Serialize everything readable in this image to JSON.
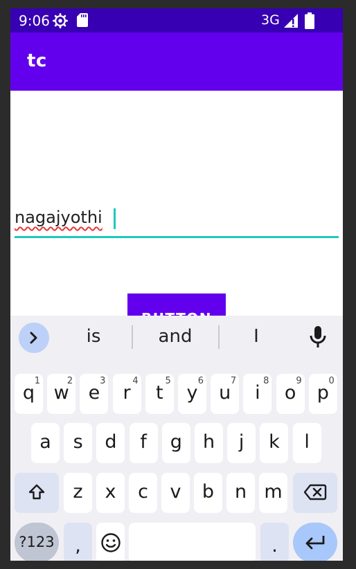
{
  "status_bar": {
    "time": "9:06",
    "network": "3G",
    "icons": [
      "gear-icon",
      "sd-card-icon",
      "signal-icon",
      "battery-icon"
    ]
  },
  "app_bar": {
    "title": "tc"
  },
  "form": {
    "text_value": "nagajyothi",
    "button_label": "BUTTON"
  },
  "keyboard": {
    "suggestions": [
      "is",
      "and",
      "I"
    ],
    "row1": [
      {
        "k": "q",
        "h": "1"
      },
      {
        "k": "w",
        "h": "2"
      },
      {
        "k": "e",
        "h": "3"
      },
      {
        "k": "r",
        "h": "4"
      },
      {
        "k": "t",
        "h": "5"
      },
      {
        "k": "y",
        "h": "6"
      },
      {
        "k": "u",
        "h": "7"
      },
      {
        "k": "i",
        "h": "8"
      },
      {
        "k": "o",
        "h": "9"
      },
      {
        "k": "p",
        "h": "0"
      }
    ],
    "row2": [
      "a",
      "s",
      "d",
      "f",
      "g",
      "h",
      "j",
      "k",
      "l"
    ],
    "row3": [
      "z",
      "x",
      "c",
      "v",
      "b",
      "n",
      "m"
    ],
    "symbols_label": "?123",
    "comma_label": ",",
    "period_label": "."
  },
  "colors": {
    "status_bar": "#3700b3",
    "app_bar": "#6200ee",
    "accent": "#1fc8b8",
    "spell_error": "#e53935"
  }
}
